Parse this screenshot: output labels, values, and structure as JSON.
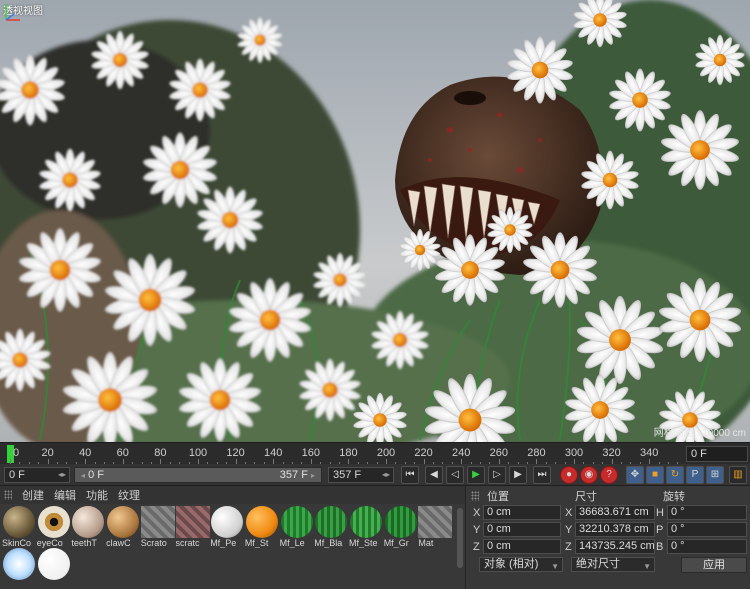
{
  "viewport": {
    "title": "透视视图",
    "grid_info": "网格间距 : 10000 cm"
  },
  "timeline": {
    "ticks": [
      "0",
      "20",
      "40",
      "60",
      "80",
      "100",
      "120",
      "140",
      "160",
      "180",
      "200",
      "220",
      "240",
      "260",
      "280",
      "300",
      "320",
      "340"
    ],
    "current_frame_right": "0 F"
  },
  "transport": {
    "current_frame": "0 F",
    "range_start": "0 F",
    "range_end": "357 F",
    "max_frame": "357 F"
  },
  "materials": {
    "menu": [
      "创建",
      "编辑",
      "功能",
      "纹理"
    ],
    "items": [
      {
        "label": "SkinCo",
        "kind": "skin"
      },
      {
        "label": "eyeCo",
        "kind": "eye"
      },
      {
        "label": "teethT",
        "kind": "teeth"
      },
      {
        "label": "clawC",
        "kind": "claw"
      },
      {
        "label": "Scrato",
        "kind": "scratch-grey"
      },
      {
        "label": "scratc",
        "kind": "scratch-red"
      },
      {
        "label": "Mf_Pe",
        "kind": "petal"
      },
      {
        "label": "Mf_St",
        "kind": "orange"
      },
      {
        "label": "Mf_Le",
        "kind": "green"
      },
      {
        "label": "Mf_Bla",
        "kind": "green2"
      },
      {
        "label": "Mf_Ste",
        "kind": "green3"
      },
      {
        "label": "Mf_Gr",
        "kind": "green4"
      },
      {
        "label": "Mat",
        "kind": "plain"
      },
      {
        "label": "",
        "kind": "light"
      },
      {
        "label": "",
        "kind": "white"
      }
    ]
  },
  "coordinates": {
    "headers": {
      "position": "位置",
      "size": "尺寸",
      "rotation": "旋转"
    },
    "rows": [
      {
        "axis": "X",
        "pos": "0 cm",
        "size_axis": "X",
        "size": "36683.671 cm",
        "rot_axis": "H",
        "rot": "0 °"
      },
      {
        "axis": "Y",
        "pos": "0 cm",
        "size_axis": "Y",
        "size": "32210.378 cm",
        "rot_axis": "P",
        "rot": "0 °"
      },
      {
        "axis": "Z",
        "pos": "0 cm",
        "size_axis": "Z",
        "size": "143735.245 cm",
        "rot_axis": "B",
        "rot": "0 °"
      }
    ],
    "mode_dropdown": "对象 (相对)",
    "size_dropdown": "绝对尺寸",
    "apply_label": "应用"
  },
  "colors": {
    "playhead": "#33d13a",
    "accent_orange": "#f08a10"
  }
}
